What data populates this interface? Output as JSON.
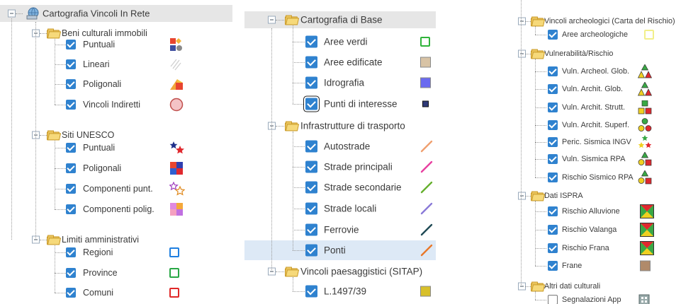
{
  "panel1": {
    "root": {
      "label": "Cartografia Vincoli In Rete",
      "icon": "globe-layers-icon"
    },
    "groups": [
      {
        "label": "Beni culturali immobili",
        "items": [
          {
            "label": "Puntuali",
            "legend": "mixed-shapes-icon"
          },
          {
            "label": "Lineari",
            "legend": "hatched-lines-icon"
          },
          {
            "label": "Poligonali",
            "legend": "mixed-polygons-icon"
          },
          {
            "label": "Vincoli Indiretti",
            "legend": "pink-circle-icon"
          }
        ]
      },
      {
        "label": "Siti UNESCO",
        "items": [
          {
            "label": "Puntuali",
            "legend": "star-icon"
          },
          {
            "label": "Poligonali",
            "legend": "color-squares-icon"
          },
          {
            "label": "Componenti punt.",
            "legend": "outlined-star-icon"
          },
          {
            "label": "Componenti polig.",
            "legend": "pastel-squares-icon"
          }
        ]
      },
      {
        "label": "Limiti amministrativi",
        "items": [
          {
            "label": "Regioni",
            "legend": "blue-square-outline-icon",
            "color": "#1f7fe0"
          },
          {
            "label": "Province",
            "legend": "green-square-outline-icon",
            "color": "#28a745"
          },
          {
            "label": "Comuni",
            "legend": "red-square-outline-icon",
            "color": "#e02828"
          }
        ]
      }
    ]
  },
  "panel2": {
    "groups": [
      {
        "label": "Cartografia di Base",
        "items": [
          {
            "label": "Aree verdi",
            "legend": "green-square-outline-icon",
            "color": "#2fb33a"
          },
          {
            "label": "Aree edificate",
            "legend": "tan-square-icon",
            "color": "#d8c3a5"
          },
          {
            "label": "Idrografia",
            "legend": "blue-square-icon",
            "color": "#6a6af0"
          },
          {
            "label": "Punti di interesse",
            "legend": "small-navy-square-icon",
            "color": "#2f3a78"
          }
        ]
      },
      {
        "label": "Infrastrutture di trasporto",
        "items": [
          {
            "label": "Autostrade",
            "legend": "orange-line-icon",
            "color": "#f0a070"
          },
          {
            "label": "Strade principali",
            "legend": "pink-line-icon",
            "color": "#e83fa0"
          },
          {
            "label": "Strade secondarie",
            "legend": "green-line-icon",
            "color": "#66b02e"
          },
          {
            "label": "Strade locali",
            "legend": "purple-line-icon",
            "color": "#8a7ad8"
          },
          {
            "label": "Ferrovie",
            "legend": "dark-teal-line-icon",
            "color": "#1f4a55"
          },
          {
            "label": "Ponti",
            "legend": "orange-line-icon",
            "color": "#e8782a"
          }
        ]
      },
      {
        "label": "Vincoli paesaggistici (SITAP)",
        "items": [
          {
            "label": "L.1497/39",
            "legend": "olive-square-icon",
            "color": "#d8c02a"
          }
        ]
      }
    ]
  },
  "panel3": {
    "groups": [
      {
        "label": "Vincoli archeologici (Carta del Rischio)",
        "items": [
          {
            "label": "Aree archeologiche",
            "legend": "yellow-square-outline-icon",
            "color": "#f2ef8a"
          }
        ]
      },
      {
        "label": "Vulnerabilità/Rischio",
        "items": [
          {
            "label": "Vuln. Archeol. Glob.",
            "legend": "triangles-icon"
          },
          {
            "label": "Vuln. Archit. Glob.",
            "legend": "triangles-icon"
          },
          {
            "label": "Vuln. Archit. Strutt.",
            "legend": "squares-icon"
          },
          {
            "label": "Vuln. Archit. Superf.",
            "legend": "circles-icon"
          },
          {
            "label": "Peric. Sismica INGV",
            "legend": "stars-icon"
          },
          {
            "label": "Vuln. Sismica RPA",
            "legend": "shapes-icon"
          },
          {
            "label": "Rischio Sismico RPA",
            "legend": "shapes-icon"
          }
        ]
      },
      {
        "label": "Dati ISPRA",
        "items": [
          {
            "label": "Rischio Alluvione",
            "legend": "hazard-map-icon"
          },
          {
            "label": "Rischio Valanga",
            "legend": "hazard-map-icon"
          },
          {
            "label": "Rischio Frana",
            "legend": "hazard-map-icon"
          },
          {
            "label": "Frane",
            "legend": "brown-square-icon",
            "color": "#b08a6a"
          }
        ]
      },
      {
        "label": "Altri dati culturali",
        "items": [
          {
            "label": "Segnalazioni App",
            "legend": "app-icon",
            "checked": false
          }
        ]
      }
    ]
  }
}
